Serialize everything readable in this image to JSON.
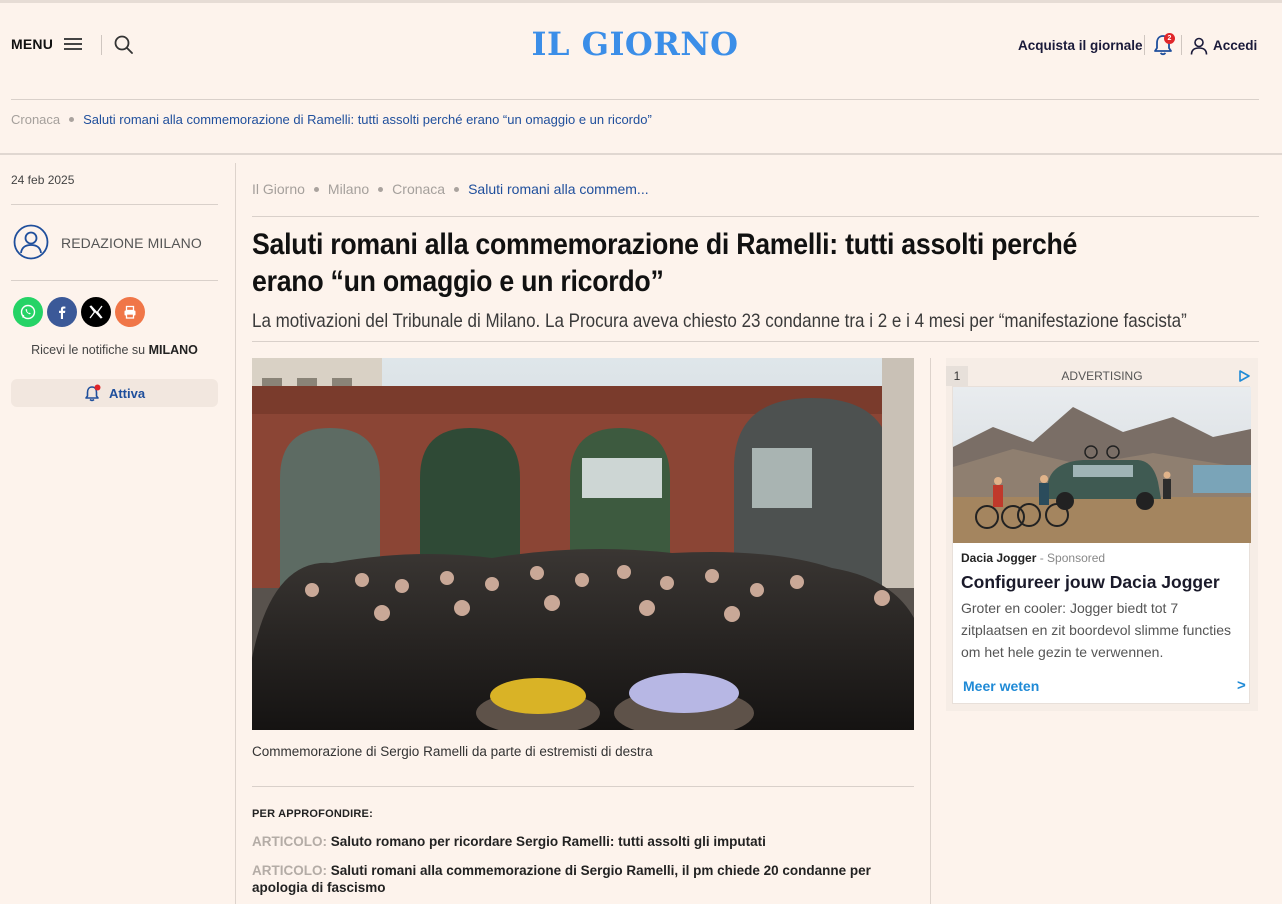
{
  "header": {
    "menu_label": "MENU",
    "logo": "IL GIORNO",
    "buy_label": "Acquista il giornale",
    "notification_count": "2",
    "login_label": "Accedi"
  },
  "top_breadcrumb": {
    "section": "Cronaca",
    "current": "Saluti romani alla commemorazione di Ramelli: tutti assolti perché erano “un omaggio e un ricordo”"
  },
  "sidebar": {
    "date": "24 feb 2025",
    "author": "REDAZIONE MILANO",
    "share": [
      {
        "name": "whatsapp",
        "color": "#25d366"
      },
      {
        "name": "facebook",
        "color": "#3b5998"
      },
      {
        "name": "x",
        "color": "#000000"
      },
      {
        "name": "print",
        "color": "#f07648"
      }
    ],
    "notif_prefix": "Ricevi le notifiche su",
    "notif_topic": "MILANO",
    "activate_label": "Attiva"
  },
  "article": {
    "breadcrumb": [
      "Il Giorno",
      "Milano",
      "Cronaca",
      "Saluti romani alla commem..."
    ],
    "title": "Saluti romani alla commemorazione di Ramelli: tutti assolti perché erano “un omaggio e un ricordo”",
    "subtitle": "La motivazioni del Tribunale di Milano. La Procura aveva chiesto 23 condanne tra i 2 e i 4 mesi per “manifestazione fascista”",
    "caption": "Commemorazione di Sergio Ramelli da parte di estremisti di destra",
    "related_label": "PER APPROFONDIRE:",
    "related": [
      {
        "tag": "ARTICOLO:",
        "text": "Saluto romano per ricordare Sergio Ramelli: tutti assolti gli imputati"
      },
      {
        "tag": "ARTICOLO:",
        "text": "Saluti romani alla commemorazione di Sergio Ramelli, il pm chiede 20 condanne per apologia di fascismo"
      }
    ]
  },
  "ad": {
    "index": "1",
    "label": "ADVERTISING",
    "brand": "Dacia Jogger",
    "sponsored": "- Sponsored",
    "headline": "Configureer jouw Dacia Jogger",
    "body": "Groter en cooler: Jogger biedt tot 7 zitplaatsen en zit boordevol slimme functies om het hele gezin te verwennen.",
    "cta": "Meer weten",
    "cta_arrow": ">"
  },
  "colors": {
    "background": "#fdf3ec",
    "logo_blue": "#3b8ee8",
    "link_blue": "#1f4f9c",
    "badge_red": "#e0262a"
  }
}
